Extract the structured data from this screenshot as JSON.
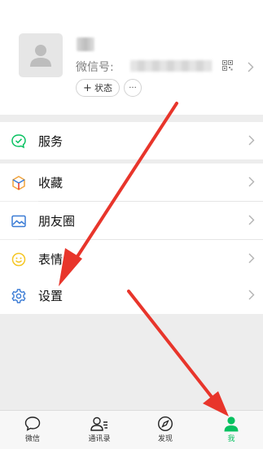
{
  "profile": {
    "wechat_id_label": "微信号:",
    "status_label": "状态",
    "more_label": "···"
  },
  "menu": {
    "services": "服务",
    "favorites": "收藏",
    "moments": "朋友圈",
    "stickers": "表情",
    "settings": "设置"
  },
  "tabbar": {
    "chats": "微信",
    "contacts": "通讯录",
    "discover": "发现",
    "me": "我"
  },
  "colors": {
    "accent_green": "#07c160",
    "arrow_red": "#e8352b",
    "favorites_orange": "#f2a33a",
    "icon_blue": "#3a7bd5",
    "sticker_yellow": "#f5c623"
  },
  "icons": {
    "services": "service-check-icon",
    "favorites": "cube-icon",
    "moments": "picture-icon",
    "stickers": "smile-icon",
    "settings": "gear-icon",
    "chats": "chat-bubble-icon",
    "contacts": "contacts-icon",
    "discover": "compass-icon",
    "me": "person-icon"
  }
}
